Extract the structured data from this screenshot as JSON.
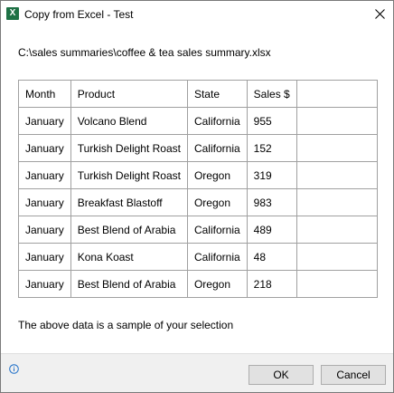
{
  "window": {
    "title": "Copy from Excel - Test",
    "app_icon_letter": "X",
    "app_icon_color": "#1e7145"
  },
  "file_path": "C:\\sales summaries\\coffee & tea sales summary.xlsx",
  "table": {
    "headers": [
      "Month",
      "Product",
      "State",
      "Sales $",
      ""
    ],
    "rows": [
      [
        "January",
        "Volcano Blend",
        "California",
        "955",
        ""
      ],
      [
        "January",
        "Turkish Delight Roast",
        "California",
        "152",
        ""
      ],
      [
        "January",
        "Turkish Delight Roast",
        "Oregon",
        "319",
        ""
      ],
      [
        "January",
        "Breakfast Blastoff",
        "Oregon",
        "983",
        ""
      ],
      [
        "January",
        "Best Blend of Arabia",
        "California",
        "489",
        ""
      ],
      [
        "January",
        "Kona Koast",
        "California",
        "48",
        ""
      ],
      [
        "January",
        "Best Blend of Arabia",
        "Oregon",
        "218",
        ""
      ]
    ]
  },
  "caption": "The above data is a sample of your selection",
  "footer": {
    "ok_label": "OK",
    "cancel_label": "Cancel",
    "info_icon": "info-icon"
  },
  "colors": {
    "footer_bg": "#f0f0f0",
    "grid_border": "#a0a0a0",
    "info_blue": "#1e6fc8"
  }
}
